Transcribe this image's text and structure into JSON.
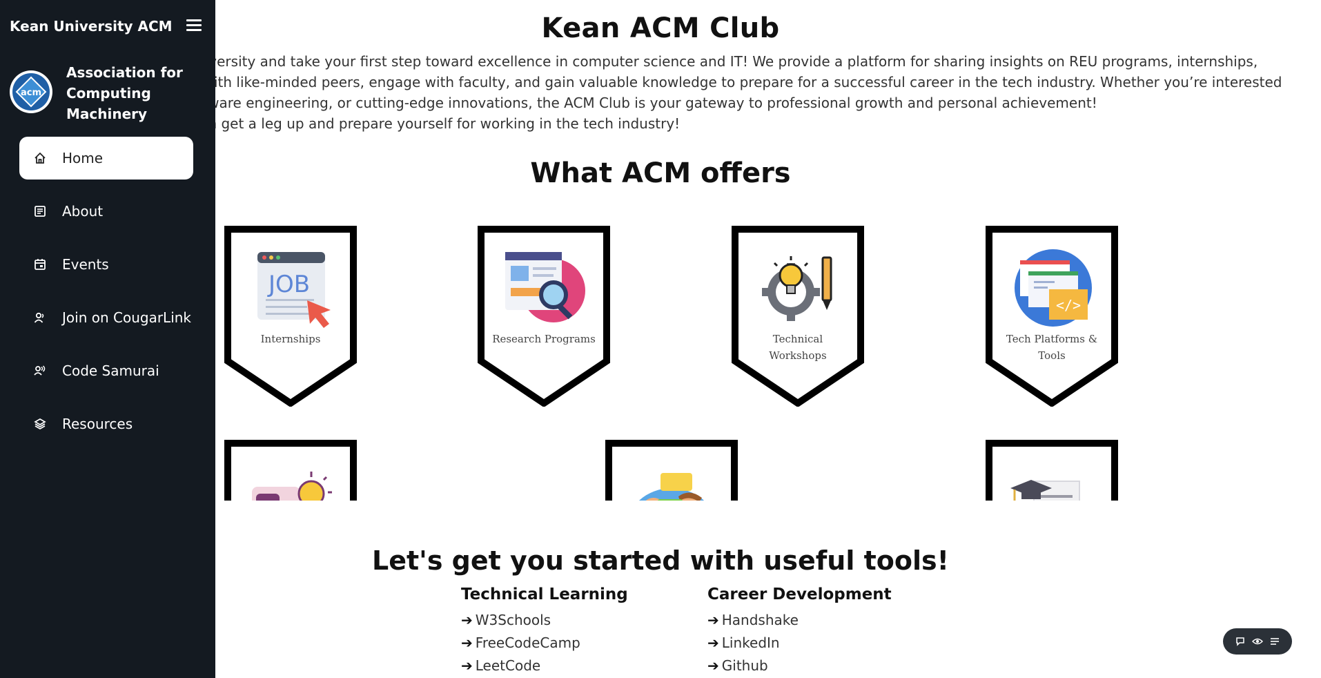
{
  "sidebar": {
    "brand": "Kean University ACM",
    "org_name_lines": [
      "Association for",
      "Computing",
      "Machinery"
    ],
    "logo_text": "acm",
    "items": [
      {
        "label": "Home",
        "icon": "home-icon",
        "active": true
      },
      {
        "label": "About",
        "icon": "document-icon",
        "active": false
      },
      {
        "label": "Events",
        "icon": "calendar-icon",
        "active": false
      },
      {
        "label": "Join on CougarLink",
        "icon": "user-join-icon",
        "active": false
      },
      {
        "label": "Code Samurai",
        "icon": "users-icon",
        "active": false
      },
      {
        "label": "Resources",
        "icon": "layers-icon",
        "active": false
      }
    ]
  },
  "hero": {
    "title": "Kean ACM Club",
    "lines": [
      "Club at Kean University and take your first step toward excellence in computer science and IT! We provide a platform for sharing insights on REU programs, internships,",
      "rends. Connect with like-minded peers, engage with faculty, and gain valuable knowledge to prepare for a successful career in the tech industry. Whether you’re interested",
      "velopment, hardware engineering, or cutting-edge innovations, the ACM Club is your gateway to professional growth and personal achievement!",
      "earn how you can get a leg up and prepare yourself for working in the tech industry!"
    ]
  },
  "offers": {
    "title": "What ACM offers",
    "badges": [
      {
        "label": "Internships",
        "icon": "job-icon"
      },
      {
        "label": "Research Programs",
        "icon": "research-icon"
      },
      {
        "label": "Technical Workshops",
        "icon": "workshop-icon"
      },
      {
        "label": "Tech Platforms & Tools",
        "icon": "platforms-icon"
      }
    ],
    "badges_row2_icons": [
      "idea-icon",
      "discussion-icon",
      "graduation-icon"
    ]
  },
  "tools": {
    "title": "Let's get you started with useful tools!",
    "arrow": "➔",
    "technical": {
      "heading": "Technical Learning",
      "links": [
        "W3Schools",
        "FreeCodeCamp",
        "LeetCode"
      ]
    },
    "career": {
      "heading": "Career Development",
      "links": [
        "Handshake",
        "LinkedIn",
        "Github"
      ]
    }
  },
  "widget": {
    "icons": [
      "chat-icon",
      "eye-icon",
      "list-icon"
    ]
  },
  "colors": {
    "sidebar_bg": "#141a21",
    "active_item_bg": "#ffffff",
    "text": "#111111"
  }
}
